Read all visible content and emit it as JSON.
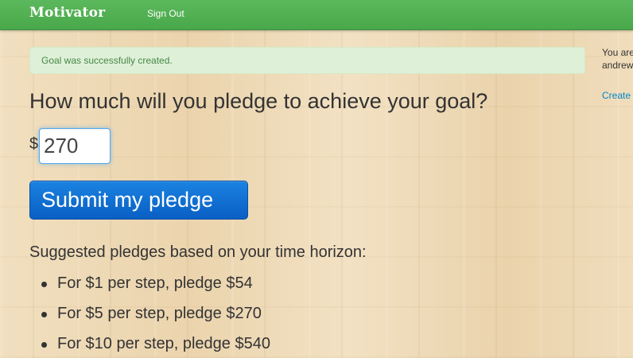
{
  "navbar": {
    "brand": "Motivator",
    "sign_out": "Sign Out"
  },
  "alert": {
    "message": "Goal was successfully created."
  },
  "main": {
    "heading": "How much will you pledge to achieve your goal?",
    "currency_symbol": "$",
    "pledge_value": "270",
    "submit_label": "Submit my pledge",
    "suggestions_title": "Suggested pledges based on your time horizon:",
    "suggestions": [
      "For $1 per step, pledge $54",
      "For $5 per step, pledge $270",
      "For $10 per step, pledge $540"
    ]
  },
  "sidebar": {
    "line1": "You are",
    "line2": "andrew",
    "create_link": "Create"
  },
  "colors": {
    "navbar_green": "#5cb85c",
    "alert_bg": "#dff0d8",
    "alert_text": "#468847",
    "button_blue": "#0a6fd6",
    "link_blue": "#0088cc"
  }
}
